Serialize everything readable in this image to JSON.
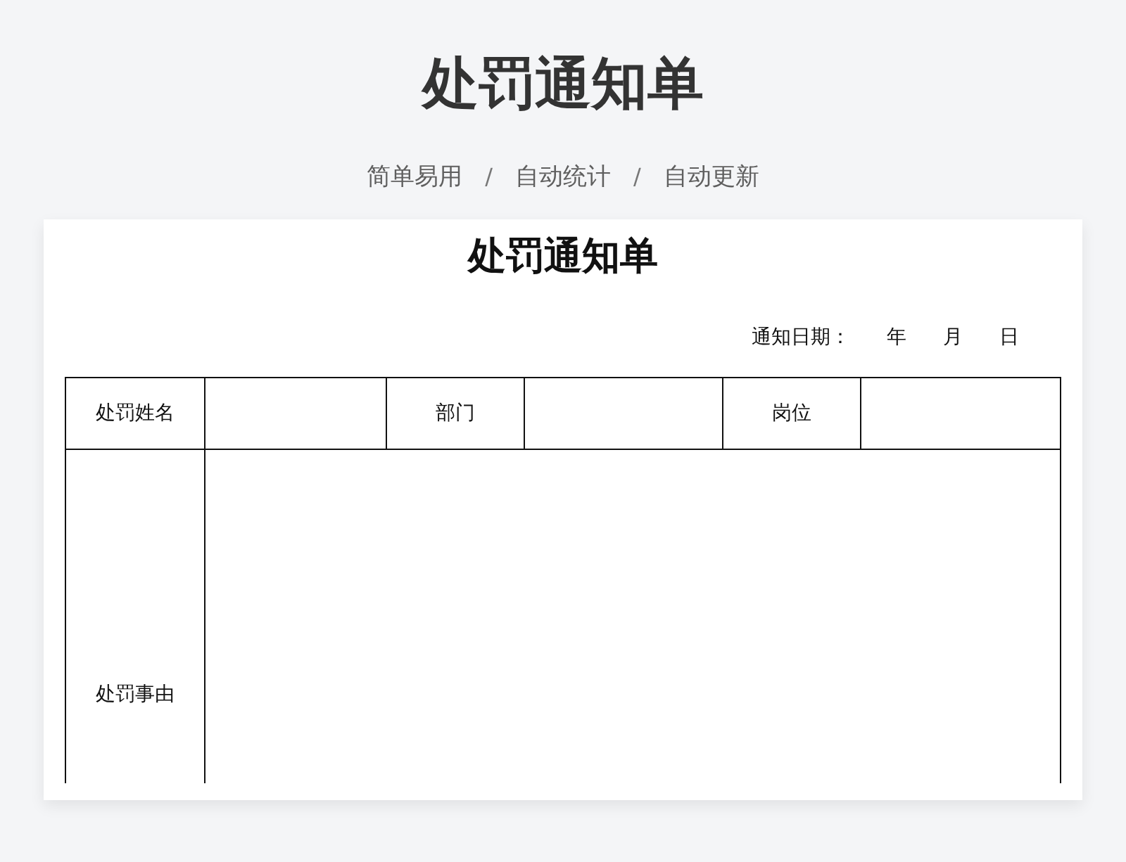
{
  "header": {
    "title": "处罚通知单",
    "subtitle": [
      {
        "kind": "feature",
        "text": "简单易用"
      },
      {
        "kind": "separator",
        "text": "/"
      },
      {
        "kind": "feature",
        "text": "自动统计"
      },
      {
        "kind": "separator",
        "text": "/"
      },
      {
        "kind": "feature",
        "text": "自动更新"
      }
    ]
  },
  "document": {
    "title": "处罚通知单",
    "date": {
      "label": "通知日期：",
      "year": "年",
      "month": "月",
      "day": "日"
    },
    "rows": [
      {
        "kind": "info",
        "cells": [
          {
            "kind": "label",
            "text": "处罚姓名"
          },
          {
            "kind": "blank"
          },
          {
            "kind": "label",
            "text": "部门"
          },
          {
            "kind": "blank"
          },
          {
            "kind": "label",
            "text": "岗位"
          },
          {
            "kind": "blank"
          }
        ]
      },
      {
        "kind": "reason",
        "cells": [
          {
            "kind": "label",
            "text": "处罚事由"
          },
          {
            "kind": "blank"
          }
        ]
      }
    ]
  }
}
